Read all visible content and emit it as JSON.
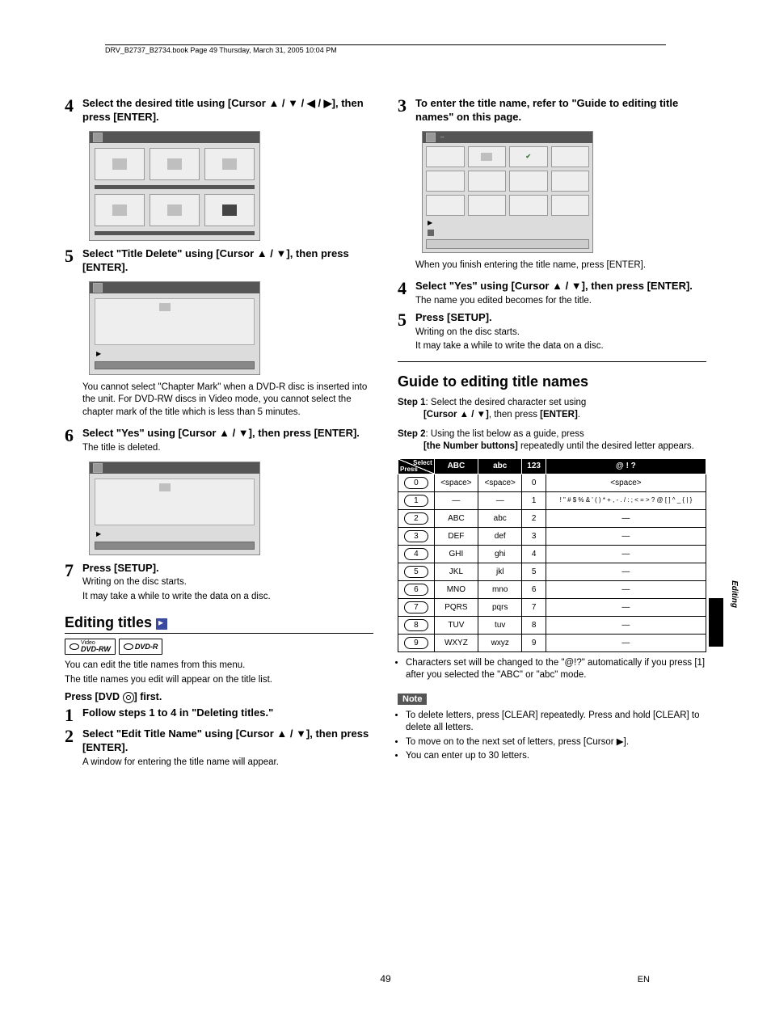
{
  "header": "DRV_B2737_B2734.book  Page 49  Thursday, March 31, 2005  10:04 PM",
  "left": {
    "s4": {
      "num": "4",
      "title": "Select the desired title using [Cursor ▲ / ▼ / ◀ / ▶], then press [ENTER]."
    },
    "s5": {
      "num": "5",
      "title": "Select \"Title Delete\" using [Cursor ▲ / ▼], then press [ENTER].",
      "note": "You cannot select \"Chapter Mark\" when a DVD-R disc is inserted into the unit. For DVD-RW discs in Video mode, you cannot select the chapter mark of the title which is less than 5 minutes."
    },
    "s6": {
      "num": "6",
      "title": "Select \"Yes\" using [Cursor ▲ / ▼], then press [ENTER].",
      "text": "The title is deleted."
    },
    "s7": {
      "num": "7",
      "title": "Press [SETUP].",
      "t1": "Writing on the disc starts.",
      "t2": "It may take a while to write the data on a disc."
    },
    "editing": {
      "heading": "Editing titles",
      "badge1a": "Video",
      "badge1b": "DVD-RW",
      "badge2": "DVD-R",
      "p1": "You can edit the title names from this menu.",
      "p2": "The title names you edit will appear on the title list.",
      "sub": "Press [DVD ⦿] first.",
      "s1": {
        "num": "1",
        "title": "Follow steps 1 to 4 in \"Deleting titles.\""
      },
      "s2": {
        "num": "2",
        "title": "Select \"Edit Title Name\" using [Cursor ▲ / ▼], then press [ENTER].",
        "text": "A window for entering the title name will appear."
      }
    }
  },
  "right": {
    "s3": {
      "num": "3",
      "title": "To enter the title name, refer to \"Guide to editing title names\" on this page.",
      "note": "When you finish entering the title name, press [ENTER]."
    },
    "s4": {
      "num": "4",
      "title": "Select \"Yes\" using [Cursor ▲ / ▼], then press [ENTER].",
      "text": "The name you edited becomes for the title."
    },
    "s5": {
      "num": "5",
      "title": "Press [SETUP].",
      "t1": "Writing on the disc starts.",
      "t2": "It may take a while to write the data on a disc."
    },
    "guide": {
      "heading": "Guide to editing title names",
      "step1a": "Step 1",
      "step1b": ": Select the desired character set using ",
      "step1c": "[Cursor ▲ / ▼]",
      "step1d": ", then press ",
      "step1e": "[ENTER]",
      "step1f": ".",
      "step2a": "Step 2",
      "step2b": ": Using the list below as a guide, press ",
      "step2c": "[the Number buttons]",
      "step2d": " repeatedly until the desired letter appears."
    },
    "table": {
      "head": [
        "Select",
        "Press",
        "ABC",
        "abc",
        "123",
        "@ ! ?"
      ],
      "rows": [
        {
          "k": "0",
          "a": "<space>",
          "b": "<space>",
          "c": "0",
          "d": "<space>"
        },
        {
          "k": "1",
          "a": "—",
          "b": "—",
          "c": "1",
          "d": "! \" # $ % & ' ( ) * + , - . / : ; < = > ? @ [ ] ^ _ { | }"
        },
        {
          "k": "2",
          "a": "ABC",
          "b": "abc",
          "c": "2",
          "d": "—"
        },
        {
          "k": "3",
          "a": "DEF",
          "b": "def",
          "c": "3",
          "d": "—"
        },
        {
          "k": "4",
          "a": "GHI",
          "b": "ghi",
          "c": "4",
          "d": "—"
        },
        {
          "k": "5",
          "a": "JKL",
          "b": "jkl",
          "c": "5",
          "d": "—"
        },
        {
          "k": "6",
          "a": "MNO",
          "b": "mno",
          "c": "6",
          "d": "—"
        },
        {
          "k": "7",
          "a": "PQRS",
          "b": "pqrs",
          "c": "7",
          "d": "—"
        },
        {
          "k": "8",
          "a": "TUV",
          "b": "tuv",
          "c": "8",
          "d": "—"
        },
        {
          "k": "9",
          "a": "WXYZ",
          "b": "wxyz",
          "c": "9",
          "d": "—"
        }
      ]
    },
    "bullet_after": "Characters set will be changed to the \"@!?\" automatically if you press [1] after you selected the \"ABC\" or \"abc\" mode.",
    "note_label": "Note",
    "notes": [
      "To delete letters, press [CLEAR] repeatedly. Press and hold [CLEAR] to delete all letters.",
      "To move on to the next set of letters, press [Cursor ▶].",
      "You can enter up to 30 letters."
    ]
  },
  "side_label": "Editing",
  "page_num": "49",
  "page_lang": "EN"
}
